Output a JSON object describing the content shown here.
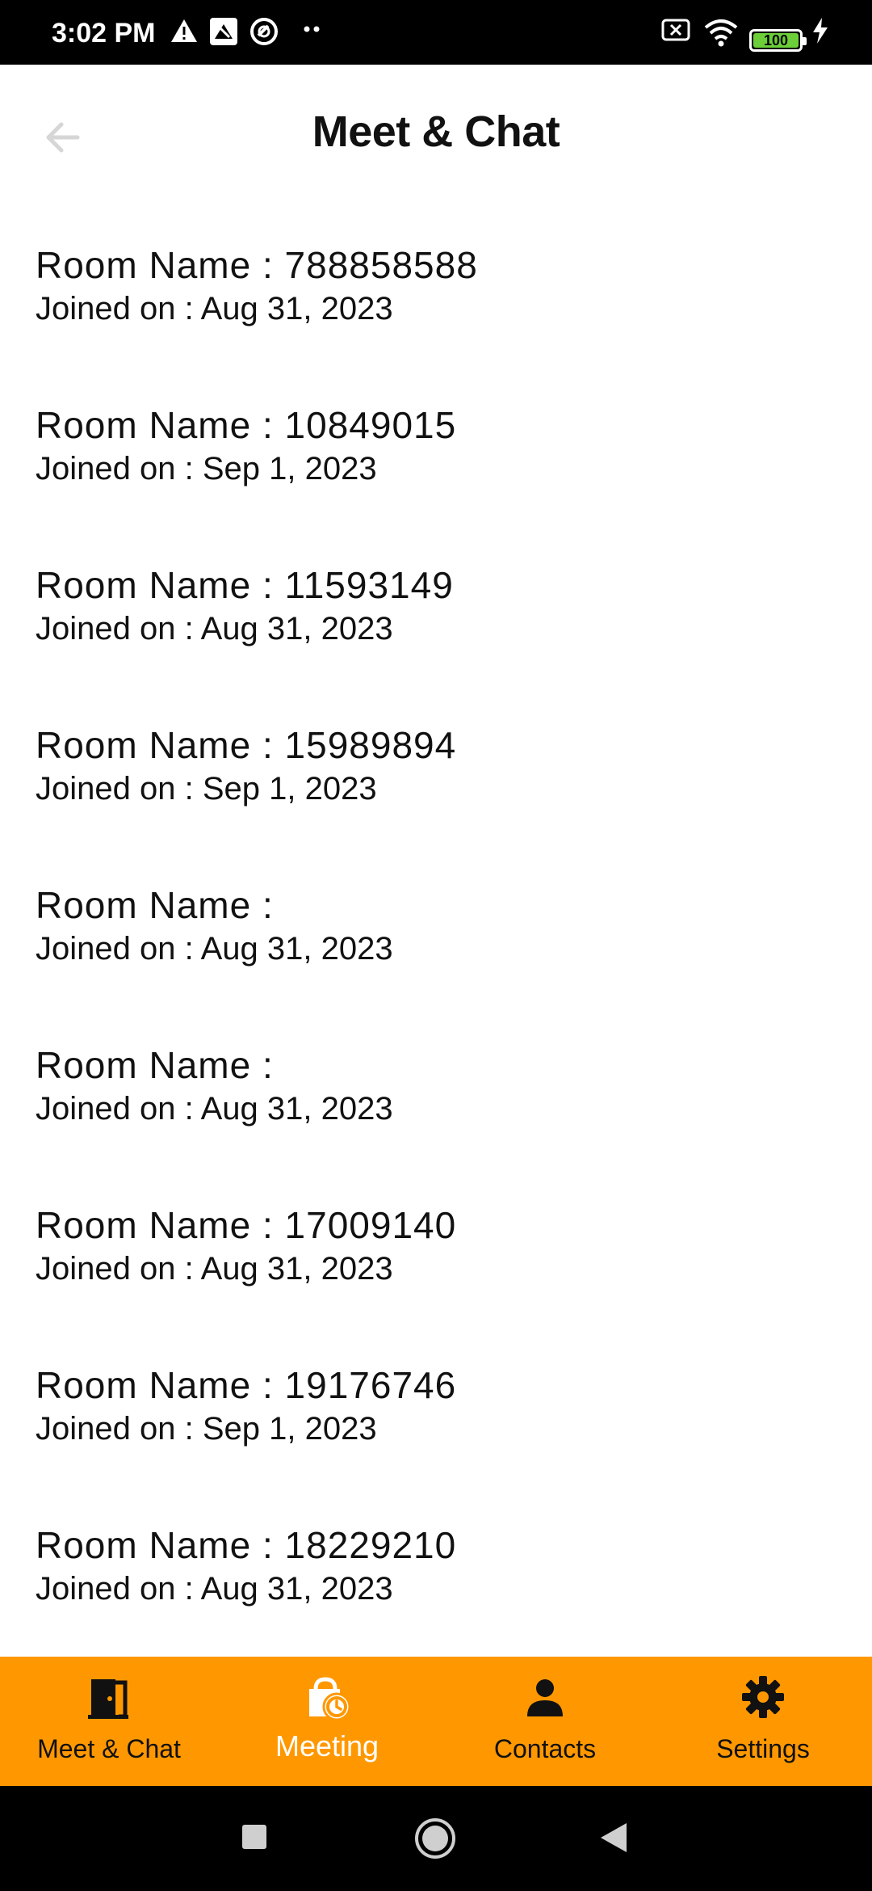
{
  "status_bar": {
    "time": "3:02 PM",
    "battery": "100"
  },
  "header": {
    "title": "Meet & Chat"
  },
  "rooms": [
    {
      "name": "Room Name : 788858588",
      "joined": "Joined on : Aug 31, 2023"
    },
    {
      "name": "Room Name : 10849015",
      "joined": "Joined on : Sep 1, 2023"
    },
    {
      "name": "Room Name : 11593149",
      "joined": "Joined on : Aug 31, 2023"
    },
    {
      "name": "Room Name : 15989894",
      "joined": "Joined on : Sep 1, 2023"
    },
    {
      "name": "Room Name : ",
      "joined": "Joined on : Aug 31, 2023"
    },
    {
      "name": "Room Name : ",
      "joined": "Joined on : Aug 31, 2023"
    },
    {
      "name": "Room Name : 17009140",
      "joined": "Joined on : Aug 31, 2023"
    },
    {
      "name": "Room Name : 19176746",
      "joined": "Joined on : Sep 1, 2023"
    },
    {
      "name": "Room Name : 18229210",
      "joined": "Joined on : Aug 31, 2023"
    }
  ],
  "bottom_nav": {
    "items": [
      {
        "label": "Meet & Chat",
        "icon": "door-icon"
      },
      {
        "label": "Meeting",
        "icon": "schedule-bag-icon",
        "active": true
      },
      {
        "label": "Contacts",
        "icon": "person-icon"
      },
      {
        "label": "Settings",
        "icon": "gear-icon"
      }
    ]
  },
  "colors": {
    "accent": "#ff9800",
    "active_label": "#ffffff"
  }
}
